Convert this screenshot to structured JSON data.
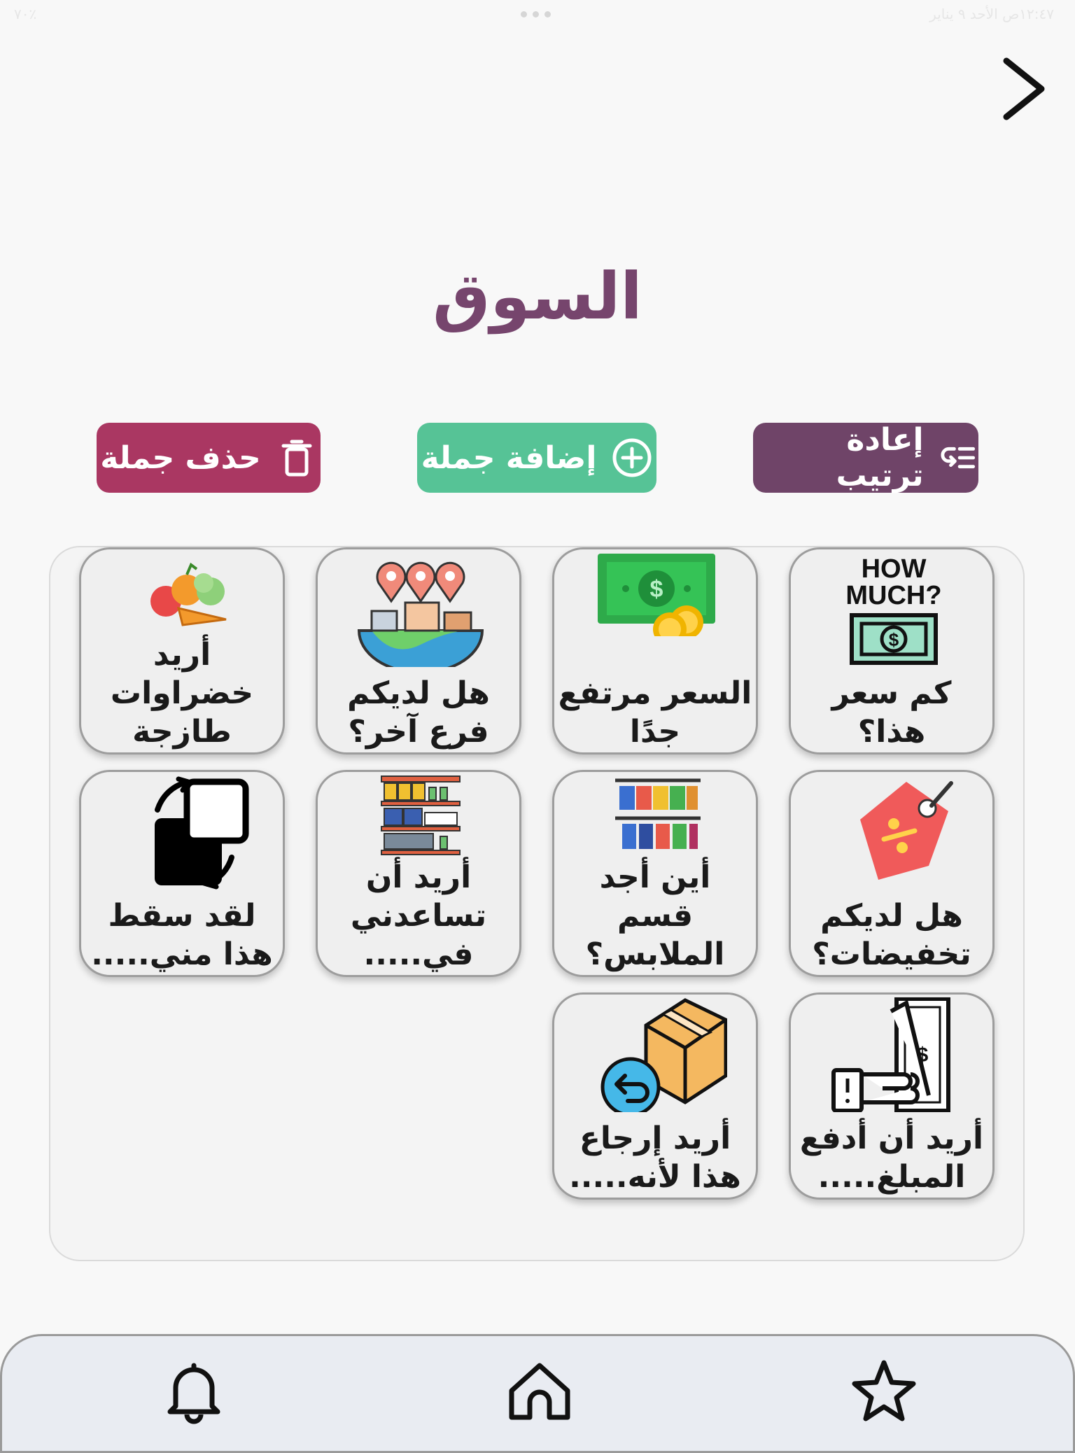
{
  "status_bar": {
    "time_date": "١٢:٤٧ص الأحد ٩ يناير",
    "battery": "٧٠٪"
  },
  "header": {
    "title": "السوق",
    "back_icon": "chevron-right-icon"
  },
  "toolbar": {
    "reorder_label": "إعادة ترتيب",
    "add_label": "إضافة جملة",
    "delete_label": "حذف جملة",
    "colors": {
      "reorder": "#6f4468",
      "add": "#56c396",
      "delete": "#aa3762"
    }
  },
  "phrases": [
    {
      "label": "كم سعر هذا؟",
      "icon": "how-much-money-icon"
    },
    {
      "label": "السعر مرتفع جدًا",
      "icon": "cash-coins-icon"
    },
    {
      "label": "هل لديكم فرع آخر؟",
      "icon": "map-pins-city-icon"
    },
    {
      "label": "أريد خضراوات طازجة",
      "icon": "vegetables-icon"
    },
    {
      "label": "هل لديكم تخفيضات؟",
      "icon": "discount-tag-icon"
    },
    {
      "label": "أين أجد قسم الملابس؟",
      "icon": "clothes-rack-icon"
    },
    {
      "label": "أريد أن تساعدني في.....",
      "icon": "store-shelves-icon"
    },
    {
      "label": "لقد سقط هذا مني.....",
      "icon": "drop-item-icon"
    },
    {
      "label": "أريد أن أدفع المبلغ.....",
      "icon": "hand-pay-money-icon"
    },
    {
      "label": "أريد إرجاع هذا لأنه.....",
      "icon": "return-box-icon"
    }
  ],
  "bottom_nav": [
    {
      "name": "favorites",
      "icon": "star-icon"
    },
    {
      "name": "home",
      "icon": "home-icon"
    },
    {
      "name": "notifications",
      "icon": "bell-icon"
    }
  ]
}
